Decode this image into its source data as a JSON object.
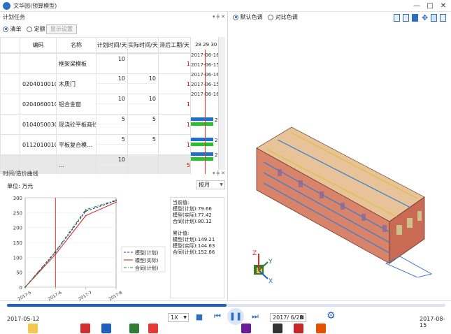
{
  "window": {
    "title": "文华园(预算模型)",
    "minimize": "—",
    "maximize": "□",
    "close": "✕"
  },
  "plan": {
    "panel_title": "计划任务",
    "pin": "▾ ╪ ✕",
    "mode_options": [
      "清单",
      "定额"
    ],
    "show_settings_label": "显示设置",
    "columns": [
      "编码",
      "名称",
      "计划时间/天",
      "实际时间/天",
      "滞后工期/天"
    ],
    "rows": [
      {
        "code": "",
        "name": "框架梁模板",
        "plan_top": "",
        "plan_bot": "10",
        "actual_top": "",
        "actual_bot": "",
        "lag": "1"
      },
      {
        "code": "020401001001",
        "name": "木质门",
        "plan_top": "10",
        "plan_bot": "",
        "actual_top": "10",
        "actual_bot": "",
        "lag": "1"
      },
      {
        "code": "020406001001",
        "name": "铝合金窗",
        "plan_top": "10",
        "plan_bot": "",
        "actual_top": "10",
        "actual_bot": "",
        "lag": "1"
      },
      {
        "code": "010405003001",
        "name": "现浇砼平板商砼",
        "plan_top": "5",
        "plan_bot": "",
        "actual_top": "5",
        "actual_bot": "",
        "lag": "1"
      },
      {
        "code": "011201001092",
        "name": "平板复合模…",
        "plan_top": "5",
        "plan_bot": "",
        "actual_top": "5",
        "actual_bot": "",
        "lag": "1"
      },
      {
        "code": "",
        "name": "…",
        "plan_top": "10",
        "plan_bot": "",
        "actual_top": "",
        "actual_bot": "",
        "lag": "5"
      }
    ],
    "gantt_header_days": [
      "28",
      "29",
      "30"
    ],
    "gantt_dates": [
      "2017-06-16",
      "2017-06-15",
      "2017-06-16",
      "2017-06-15",
      "2017-06-16"
    ],
    "gantt_bar_labels": [
      "2",
      "2",
      "2"
    ]
  },
  "curve": {
    "panel_title": "时间/造价曲线",
    "pin": "▾ ╪ ✕",
    "unit_label": "单位: 万元",
    "period_select": "按月",
    "info": {
      "current_title": "当前值:",
      "current_lines": [
        "模型(计划):79.66",
        "模型(实际):77.42",
        "合同(计划):80.12"
      ],
      "cumulative_title": "累计值:",
      "cumulative_lines": [
        "模型(计划):149.21",
        "模型(实际):144.63",
        "合同(计划):152.66"
      ]
    }
  },
  "chart_data": {
    "type": "line",
    "x": [
      "2017-5-12",
      "2017-6",
      "2017-7",
      "2017-8"
    ],
    "x_ticks": [
      "2017-5",
      "2017-6",
      "2017-7",
      "2017-8"
    ],
    "yticks": [
      0,
      50,
      100,
      150,
      200,
      250,
      300
    ],
    "ylim": [
      0,
      300
    ],
    "marker_x": "2017-6",
    "series": [
      {
        "name": "模型(计划)",
        "color": "#1f3a93",
        "values": [
          0,
          117,
          255,
          290
        ]
      },
      {
        "name": "模型(实际)",
        "color": "#d32f2f",
        "values": [
          0,
          110,
          240,
          285
        ]
      },
      {
        "name": "合同(计划)",
        "color": "#2e7d32",
        "values": [
          0,
          120,
          260,
          292
        ]
      }
    ]
  },
  "view3d": {
    "color_modes": [
      "默认色调",
      "对比色调"
    ],
    "axis_labels": [
      "Z",
      "Y",
      "X"
    ]
  },
  "timeline": {
    "start_date": "2017-05-12",
    "end_date": "2017-08-15",
    "speed": "1X",
    "current_date": "2017/ 6/28",
    "progress": 0.5
  }
}
